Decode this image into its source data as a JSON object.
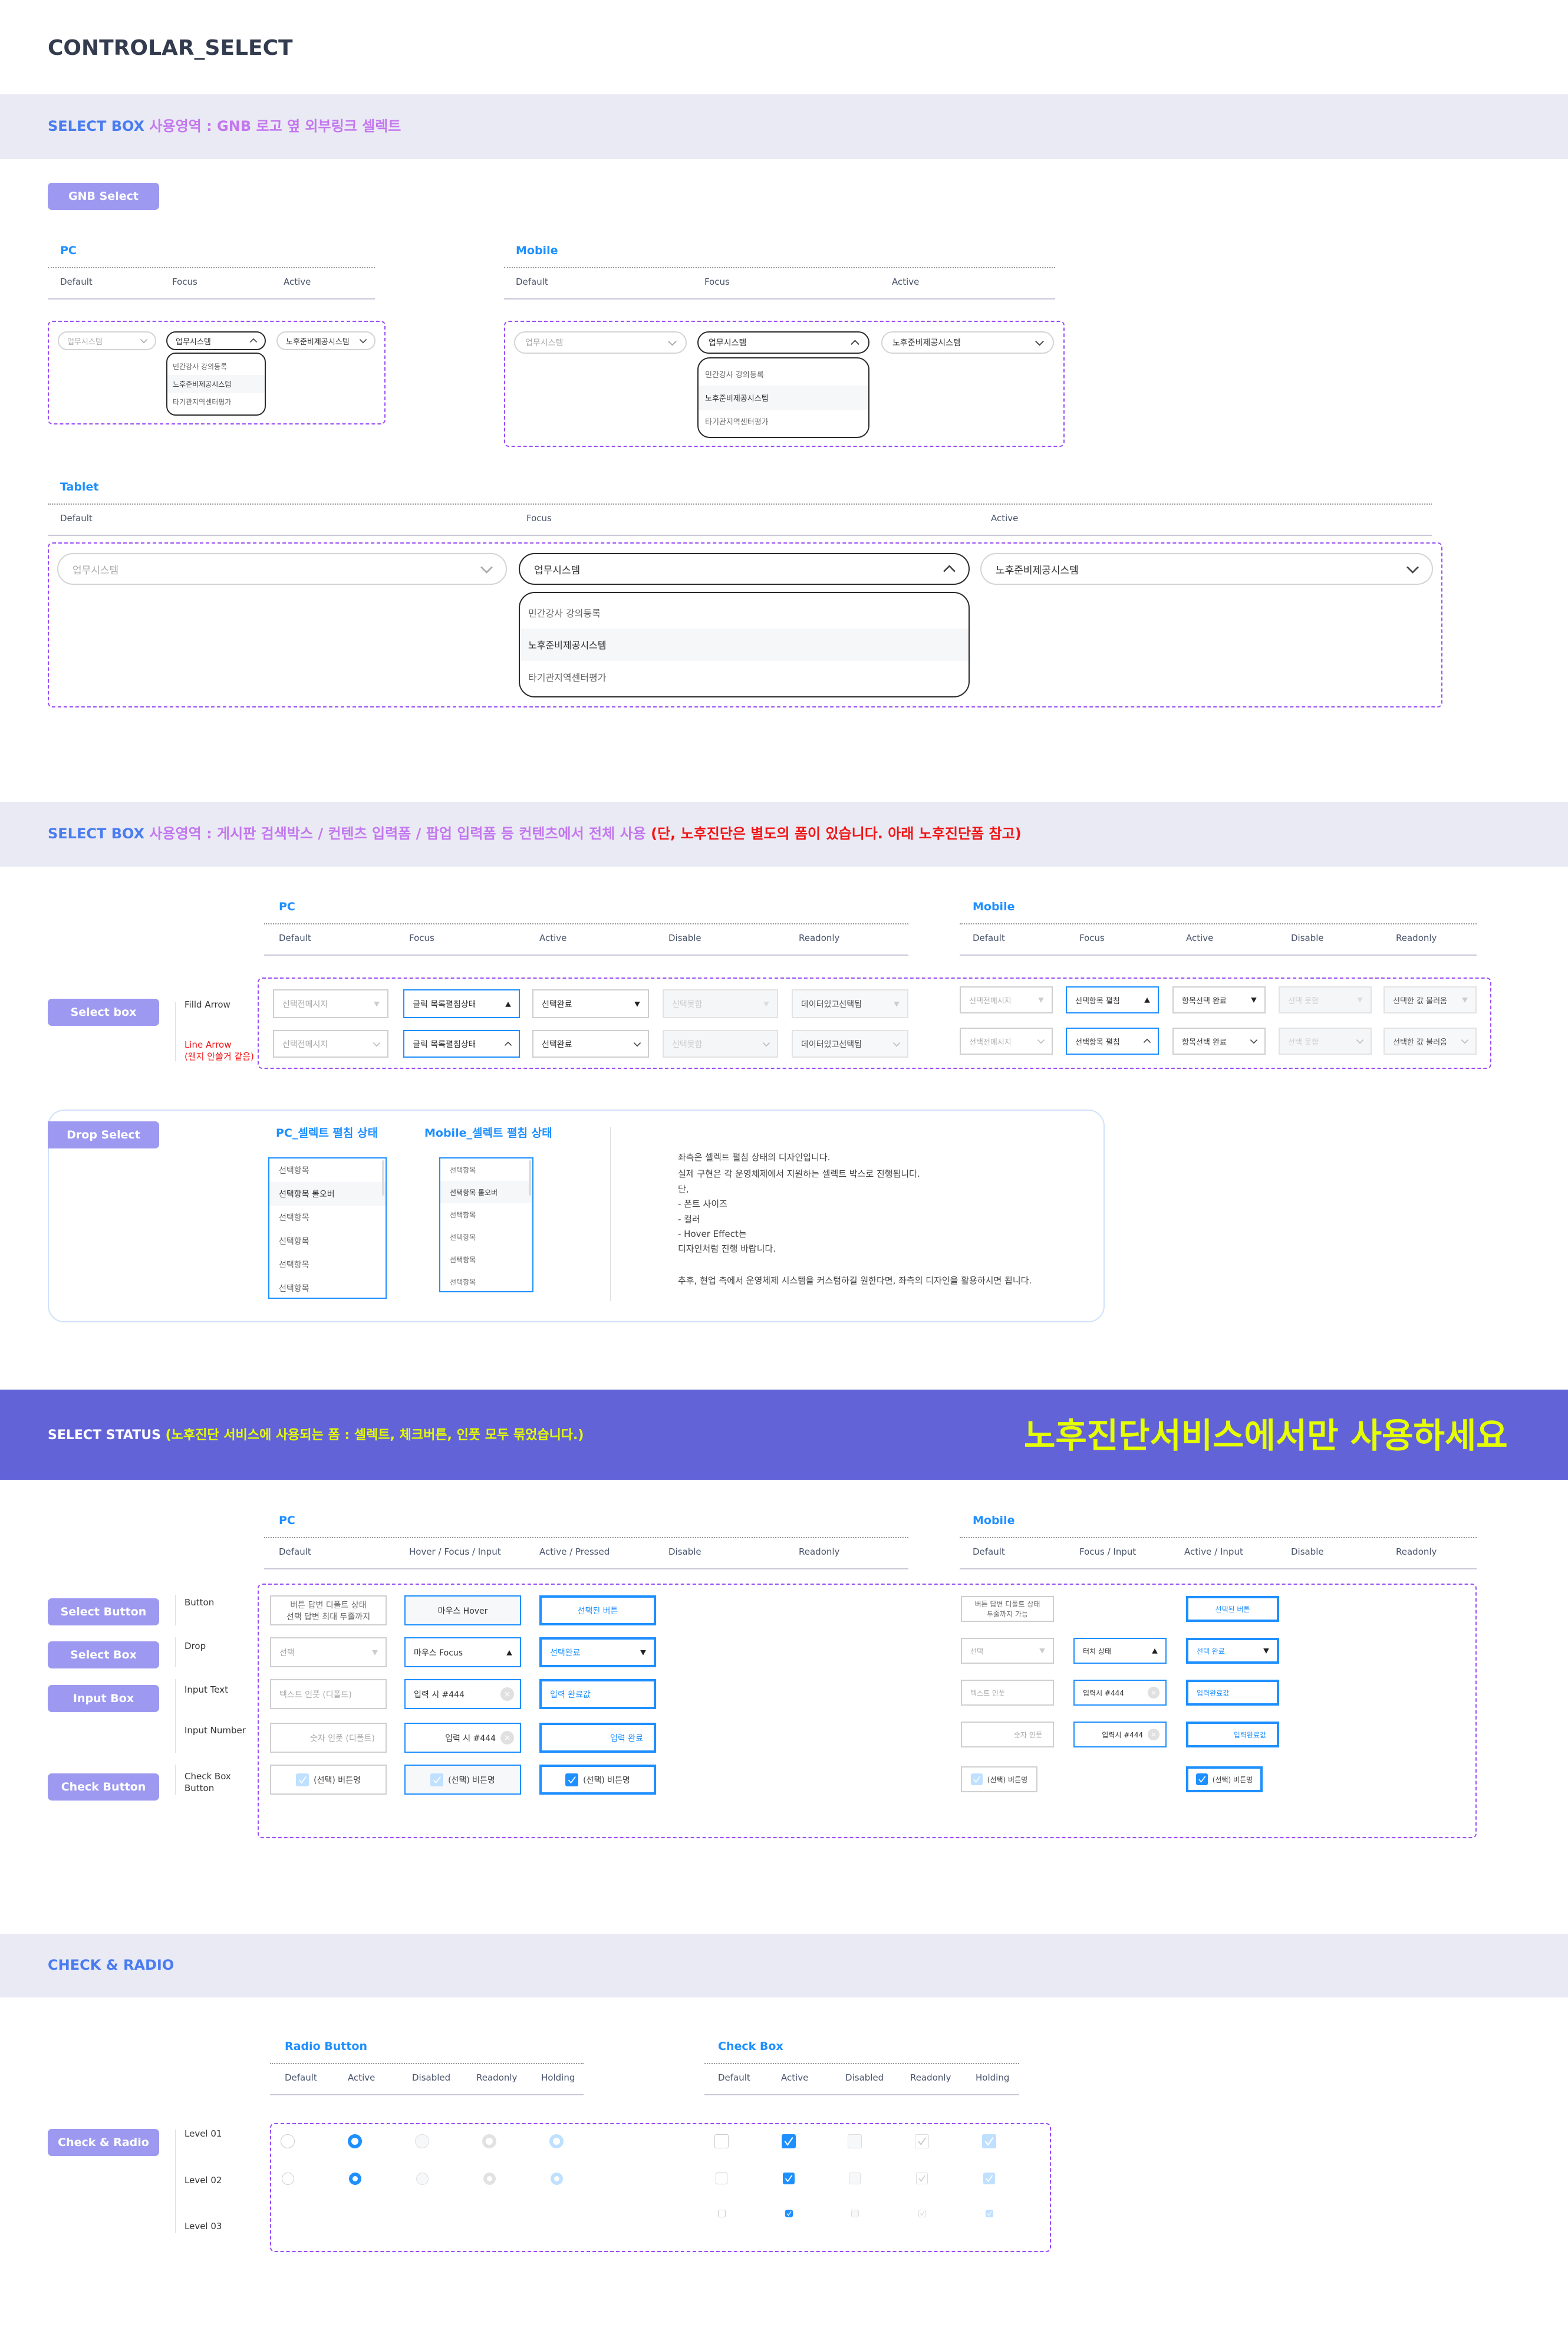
{
  "page_title": "CONTROLAR_SELECT",
  "colors": {
    "accent": "#1e8fff",
    "label_button": "#9d99f1",
    "band": "#eaeaf4",
    "status_band": "#6363d8",
    "highlight_yellow": "#e6ff00",
    "dashed_border": "#9a4cf5"
  },
  "gnb": {
    "band_label": "SELECT BOX",
    "band_desc": "사용영역 : GNB 로고 옆 외부링크 셀렉트",
    "button": "GNB Select",
    "pc": {
      "title": "PC",
      "cols": [
        "Default",
        "Focus",
        "Active"
      ]
    },
    "mobile": {
      "title": "Mobile",
      "cols": [
        "Default",
        "Focus",
        "Active"
      ]
    },
    "tablet": {
      "title": "Tablet",
      "cols": [
        "Default",
        "Focus",
        "Active"
      ]
    },
    "select_default": "업무시스템",
    "select_focus": "업무시스템",
    "select_active": "노후준비제공시스템",
    "options": [
      "민간강사 강의등록",
      "노후준비제공시스템",
      "타기관지역센터평가"
    ]
  },
  "selectbox": {
    "band_label": "SELECT BOX",
    "band_desc": "사용영역 : 게시판 검색박스 / 컨텐츠 입력폼 / 팝업 입력폼 등 컨텐츠에서 전체 사용",
    "band_note": "(단, 노후진단은 별도의 폼이 있습니다. 아래 노후진단폼 참고)",
    "button": "Select box",
    "row_labels": [
      "Filld Arrow",
      "Line Arrow",
      "(왠지 안쓸거 같음)"
    ],
    "pc": {
      "title": "PC",
      "cols": [
        "Default",
        "Focus",
        "Active",
        "Disable",
        "Readonly"
      ],
      "values": [
        "선택전메시지",
        "클릭 목록펼침상태",
        "선택완료",
        "선택못함",
        "데이터있고선택됨"
      ]
    },
    "mobile": {
      "title": "Mobile",
      "cols": [
        "Default",
        "Focus",
        "Active",
        "Disable",
        "Readonly"
      ],
      "values": [
        "선택전메시지",
        "선택항목 펼침",
        "항목선택 완료",
        "선택 못함",
        "선택한 값 불러옴"
      ]
    }
  },
  "drop": {
    "button": "Drop Select",
    "pc_title": "PC_셀렉트 펼침 상태",
    "mobile_title": "Mobile_셀렉트 펼침 상태",
    "items": [
      "선택항목",
      "선택항목 롤오버",
      "선택항목",
      "선택항목",
      "선택항목",
      "선택항목"
    ],
    "notes": [
      "좌측은 셀렉트 펼침 상태의 디자인입니다.",
      "실제 구현은 각 운영체제에서 지원하는 셀렉트 박스로 진행됩니다.",
      "단,",
      "- 폰트 사이즈",
      "- 컬러",
      "- Hover Effect는",
      "디자인처럼 진행 바랍니다.",
      "추후, 현업 측에서 운영체제 시스템을 커스텀하길 원한다면, 좌측의 디자인을 활용하시면 됩니다."
    ]
  },
  "status": {
    "band_label": "SELECT STATUS",
    "band_desc": " (노후진단 서비스에 사용되는 폼 : 셀렉트, 체크버튼, 인풋 모두 묶었습니다.)",
    "band_big": "노후진단서비스에서만 사용하세요",
    "buttons": [
      "Select Button",
      "Select Box",
      "Input Box",
      "Check Button"
    ],
    "row_labels": [
      "Button",
      "Drop",
      "Input Text",
      "Input Number",
      "Check Box\nButton"
    ],
    "pc": {
      "title": "PC",
      "cols": [
        "Default",
        "Hover / Focus / Input",
        "Active / Pressed",
        "Disable",
        "Readonly"
      ],
      "rows": [
        [
          "버튼 답변 디폴트 상태\n선택 답변 최대 두줄까지",
          "마우스 Hover",
          "선택된 버튼"
        ],
        [
          "선택",
          "마우스 Focus",
          "선택완료"
        ],
        [
          "텍스트 인풋 (디폴트)",
          "입력 시 #444",
          "입력 완료값"
        ],
        [
          "숫자 인풋 (디폴트)",
          "입력 시 #444",
          "입력 완료"
        ],
        [
          "(선택) 버튼명",
          "(선택) 버튼명",
          "(선택) 버튼명"
        ]
      ]
    },
    "mobile": {
      "title": "Mobile",
      "cols": [
        "Default",
        "Focus / Input",
        "Active / Input",
        "Disable",
        "Readonly"
      ],
      "rows": [
        [
          "버튼 답변 디폴트 상태\n두줄까지 가능",
          "",
          "선택된 버튼"
        ],
        [
          "선택",
          "터치 상태",
          "선택 완료"
        ],
        [
          "텍스트 인풋",
          "입력시 #444",
          "입력완료값"
        ],
        [
          "숫자 인풋",
          "입력시 #444",
          "입력완료값"
        ],
        [
          "(선택) 버튼명",
          "",
          "(선택) 버튼명"
        ]
      ]
    }
  },
  "checkradio": {
    "band_label": "CHECK & RADIO",
    "button": "Check & Radio",
    "levels": [
      "Level 01",
      "Level 02",
      "Level 03"
    ],
    "radio": {
      "title": "Radio Button",
      "cols": [
        "Default",
        "Active",
        "Disabled",
        "Readonly",
        "Holding"
      ]
    },
    "checkbox": {
      "title": "Check Box",
      "cols": [
        "Default",
        "Active",
        "Disabled",
        "Readonly",
        "Holding"
      ]
    }
  }
}
